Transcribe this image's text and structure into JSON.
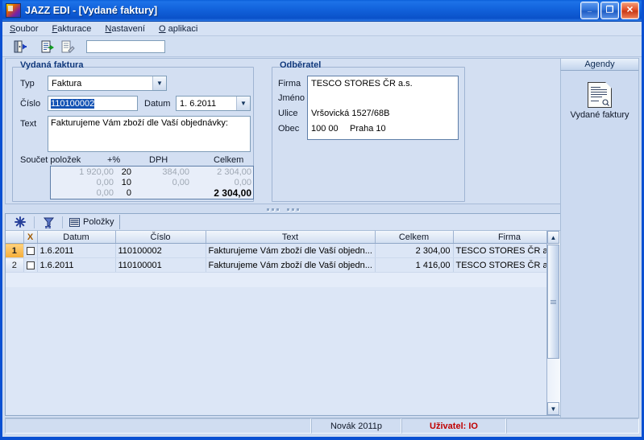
{
  "window": {
    "title": "JAZZ EDI - [Vydané faktury]",
    "icon": "app-logo-icon",
    "minimize_label": "_",
    "maximize_label": "❐",
    "close_label": "✕",
    "titlebar_color": "#0a50d2"
  },
  "menu": [
    {
      "label": "Soubor",
      "accel": "S"
    },
    {
      "label": "Fakturace",
      "accel": "F"
    },
    {
      "label": "Nastavení",
      "accel": "N"
    },
    {
      "label": "O aplikaci",
      "accel": "O"
    }
  ],
  "toolbar": {
    "buttons": [
      {
        "name": "exit-icon",
        "tip": "Konec"
      },
      {
        "name": "new-document-icon",
        "tip": "Nový"
      },
      {
        "name": "edit-document-icon",
        "tip": "Upravit"
      }
    ],
    "search_value": "",
    "search_placeholder": ""
  },
  "form": {
    "invoice": {
      "legend": "Vydaná faktura",
      "typ_label": "Typ",
      "typ_value": "Faktura",
      "cislo_label": "Číslo",
      "cislo_value": "110100002",
      "datum_label": "Datum",
      "datum_value": "1. 6.2011",
      "text_label": "Text",
      "text_value": "Fakturujeme Vám zboží dle Vaší objednávky:"
    },
    "customer": {
      "legend": "Odběratel",
      "firma_label": "Firma",
      "firma_value": "TESCO STORES ČR a.s.",
      "jmeno_label": "Jméno",
      "jmeno_value": "",
      "ulice_label": "Ulice",
      "ulice_value": "Vršovická 1527/68B",
      "obec_label": "Obec",
      "obec_psc": "100 00",
      "obec_value": "Praha 10"
    },
    "totals": {
      "title": "Součet položek",
      "col_rate": "+%",
      "col_dph": "DPH",
      "col_total": "Celkem",
      "rows": [
        {
          "base": "1 920,00",
          "rate": "20",
          "dph": "384,00",
          "total": "2 304,00",
          "emphasis": false
        },
        {
          "base": "0,00",
          "rate": "10",
          "dph": "0,00",
          "total": "0,00",
          "emphasis": false
        },
        {
          "base": "0,00",
          "rate": "0",
          "dph": "",
          "total": "2 304,00",
          "emphasis": true
        }
      ]
    }
  },
  "sidebar": {
    "header": "Agendy",
    "items": [
      {
        "label": "Vydané faktury",
        "icon": "document-report-icon"
      }
    ]
  },
  "grid": {
    "toolbar": {
      "star_icon": "new-record-star-icon",
      "filter_icon": "filter-funnel-icon",
      "tab_icon": "grid-rows-icon",
      "tab_label": "Položky"
    },
    "columns": [
      {
        "key": "rownum",
        "label": ""
      },
      {
        "key": "chk",
        "label": "X"
      },
      {
        "key": "datum",
        "label": "Datum"
      },
      {
        "key": "cislo",
        "label": "Číslo"
      },
      {
        "key": "text",
        "label": "Text"
      },
      {
        "key": "celkem",
        "label": "Celkem"
      },
      {
        "key": "firma",
        "label": "Firma"
      }
    ],
    "rows": [
      {
        "rownum": "1",
        "checked": false,
        "datum": "1.6.2011",
        "cislo": "110100002",
        "text": "Fakturujeme Vám zboží dle Vaší objedn...",
        "celkem": "2 304,00",
        "firma": "TESCO STORES ČR a.s.",
        "selected": true
      },
      {
        "rownum": "2",
        "checked": false,
        "datum": "1.6.2011",
        "cislo": "110100001",
        "text": "Fakturujeme Vám zboží dle Vaší objedn...",
        "celkem": "1 416,00",
        "firma": "TESCO STORES ČR a.s.",
        "selected": false
      }
    ],
    "scrollbar": {
      "up": "▲",
      "down": "▼"
    }
  },
  "status": {
    "left": "",
    "company": "Novák 2011p",
    "user": "Uživatel: IO",
    "right": ""
  }
}
